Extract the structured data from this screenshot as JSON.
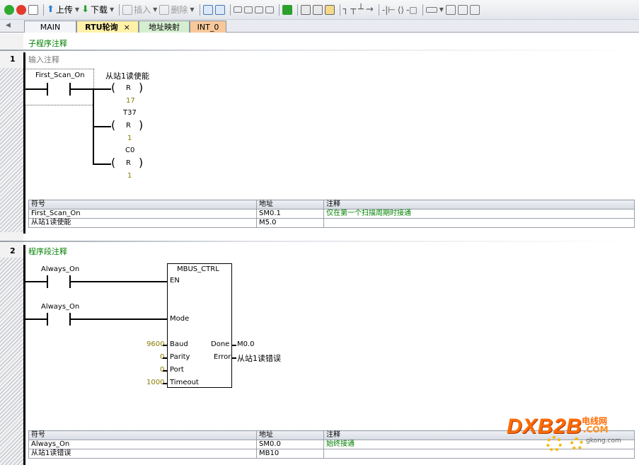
{
  "toolbar": {
    "items": [
      {
        "icon": "run-icon"
      },
      {
        "icon": "stop-icon"
      },
      {
        "icon": "compile-icon"
      },
      {
        "icon": "upload-icon",
        "label": "上传"
      },
      {
        "icon": "download-icon",
        "label": "下载"
      },
      {
        "icon": "insert-icon",
        "label": "插入"
      },
      {
        "icon": "delete-icon",
        "label": "删除"
      }
    ]
  },
  "tabs": [
    {
      "label": "MAIN"
    },
    {
      "label": "RTU轮询",
      "close": "×"
    },
    {
      "label": "地址映射"
    },
    {
      "label": "INT_0"
    }
  ],
  "network1": {
    "number": "1",
    "subroutine_comment": "子程序注释",
    "input_comment": "输入注释",
    "contact": "First_Scan_On",
    "coils": [
      {
        "name": "从站1读使能",
        "op": "R",
        "count": "17"
      },
      {
        "name": "T37",
        "op": "R",
        "count": "1"
      },
      {
        "name": "C0",
        "op": "R",
        "count": "1"
      }
    ],
    "symbols": {
      "headers": [
        "符号",
        "地址",
        "注释"
      ],
      "rows": [
        [
          "First_Scan_On",
          "SM0.1",
          "仅在第一个扫描周期时接通"
        ],
        [
          "从站1读使能",
          "M5.0",
          ""
        ]
      ]
    }
  },
  "network2": {
    "number": "2",
    "comment": "程序段注释",
    "contact_en": "Always_On",
    "contact_mode": "Always_On",
    "block": {
      "title": "MBUS_CTRL",
      "pins": {
        "en": "EN",
        "mode": "Mode",
        "baud": "Baud",
        "parity": "Parity",
        "port": "Port",
        "timeout": "Timeout",
        "done": "Done",
        "error": "Error"
      },
      "inputs": {
        "baud": "9600",
        "parity": "0",
        "port": "0",
        "timeout": "1000"
      },
      "outputs": {
        "done": "M0.0",
        "error": "从站1读错误"
      }
    },
    "symbols": {
      "headers": [
        "符号",
        "地址",
        "注释"
      ],
      "rows": [
        [
          "Always_On",
          "SM0.0",
          "始终接通"
        ],
        [
          "从站1读错误",
          "MB10",
          ""
        ]
      ]
    }
  },
  "watermark": {
    "big": "DXB2B",
    "cn": "电线网",
    "com": ".COM",
    "url": "gkong.com"
  }
}
